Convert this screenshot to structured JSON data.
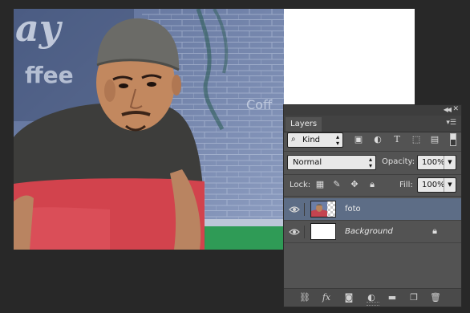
{
  "panel": {
    "title_tab": "Layers",
    "filter": {
      "kind_label": "Kind",
      "icons": [
        "image-filter-icon",
        "adjustment-filter-icon",
        "type-filter-icon",
        "shape-filter-icon",
        "smart-object-filter-icon"
      ]
    },
    "blend_mode": "Normal",
    "opacity_label": "Opacity:",
    "opacity_value": "100%",
    "lock_label": "Lock:",
    "lock_icons": [
      "lock-transparent-pixels-icon",
      "lock-image-pixels-icon",
      "lock-position-icon",
      "lock-all-icon"
    ],
    "fill_label": "Fill:",
    "fill_value": "100%",
    "layers": [
      {
        "name": "foto",
        "visible": true,
        "selected": true,
        "locked": false
      },
      {
        "name": "Background",
        "visible": true,
        "selected": false,
        "locked": true
      }
    ],
    "bottom_icons": [
      "link-layers-icon",
      "fx-icon",
      "add-mask-icon",
      "new-adjustment-layer-icon",
      "new-group-icon",
      "new-layer-icon",
      "delete-layer-icon"
    ],
    "fx_label": "fx"
  },
  "colors": {
    "app_background": "#282828",
    "panel_background": "#535353",
    "selected_layer": "#5d6d86"
  }
}
